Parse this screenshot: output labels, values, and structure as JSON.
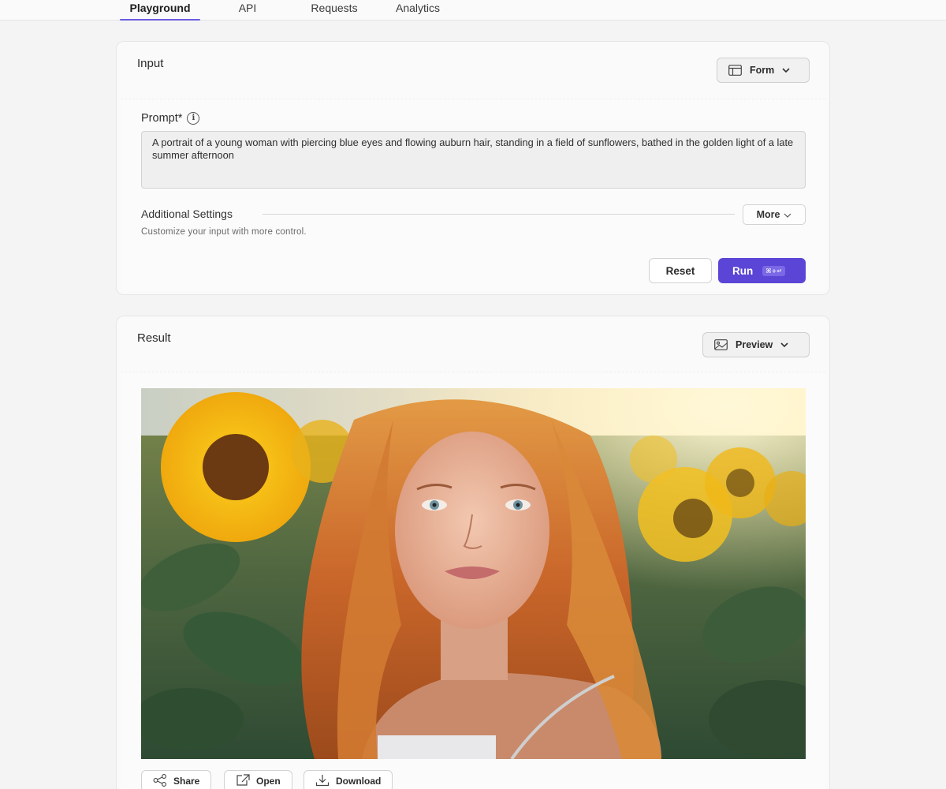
{
  "nav": {
    "tabs": [
      {
        "label": "Playground",
        "active": true
      },
      {
        "label": "API",
        "active": false
      },
      {
        "label": "Requests",
        "active": false
      },
      {
        "label": "Analytics",
        "active": false
      }
    ]
  },
  "input_card": {
    "title": "Input",
    "view_mode": {
      "label": "Form",
      "icon": "table-icon"
    },
    "prompt": {
      "label": "Prompt*",
      "value": "A portrait of a young woman with piercing blue eyes and flowing auburn hair, standing in a field of sunflowers, bathed in the golden light of a late summer afternoon"
    },
    "settings": {
      "label": "Additional Settings",
      "hint": "Customize your input with more control.",
      "more_label": "More"
    },
    "reset_label": "Reset",
    "run_label": "Run",
    "run_shortcut": "⌘+↵"
  },
  "result_card": {
    "title": "Result",
    "view_mode": {
      "label": "Preview",
      "icon": "image-icon"
    },
    "actions": [
      {
        "label": "Share",
        "icon": "share-icon"
      },
      {
        "label": "Open",
        "icon": "external-link-icon"
      },
      {
        "label": "Download",
        "icon": "download-icon"
      }
    ]
  },
  "colors": {
    "accent": "#5a45d6",
    "background": "#f4f4f4",
    "card": "#fafafa"
  }
}
